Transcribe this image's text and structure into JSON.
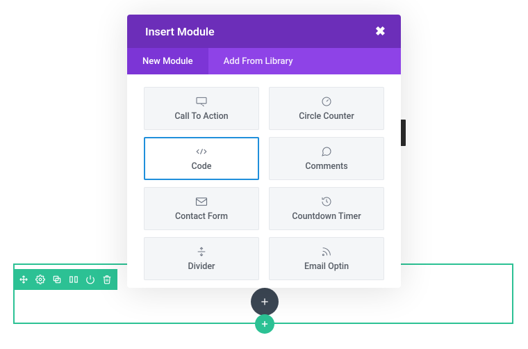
{
  "modal": {
    "title": "Insert Module",
    "tabs": {
      "new": "New Module",
      "library": "Add From Library"
    },
    "active_tab": "new",
    "modules": [
      {
        "id": "call-to-action",
        "label": "Call To Action",
        "selected": false
      },
      {
        "id": "circle-counter",
        "label": "Circle Counter",
        "selected": false
      },
      {
        "id": "code",
        "label": "Code",
        "selected": true
      },
      {
        "id": "comments",
        "label": "Comments",
        "selected": false
      },
      {
        "id": "contact-form",
        "label": "Contact Form",
        "selected": false
      },
      {
        "id": "countdown-timer",
        "label": "Countdown Timer",
        "selected": false
      },
      {
        "id": "divider",
        "label": "Divider",
        "selected": false
      },
      {
        "id": "email-optin",
        "label": "Email Optin",
        "selected": false
      }
    ]
  },
  "section": {
    "accent_color": "#2cc194",
    "toolbar_icons": [
      "move",
      "settings",
      "duplicate",
      "columns",
      "power",
      "trash"
    ]
  }
}
